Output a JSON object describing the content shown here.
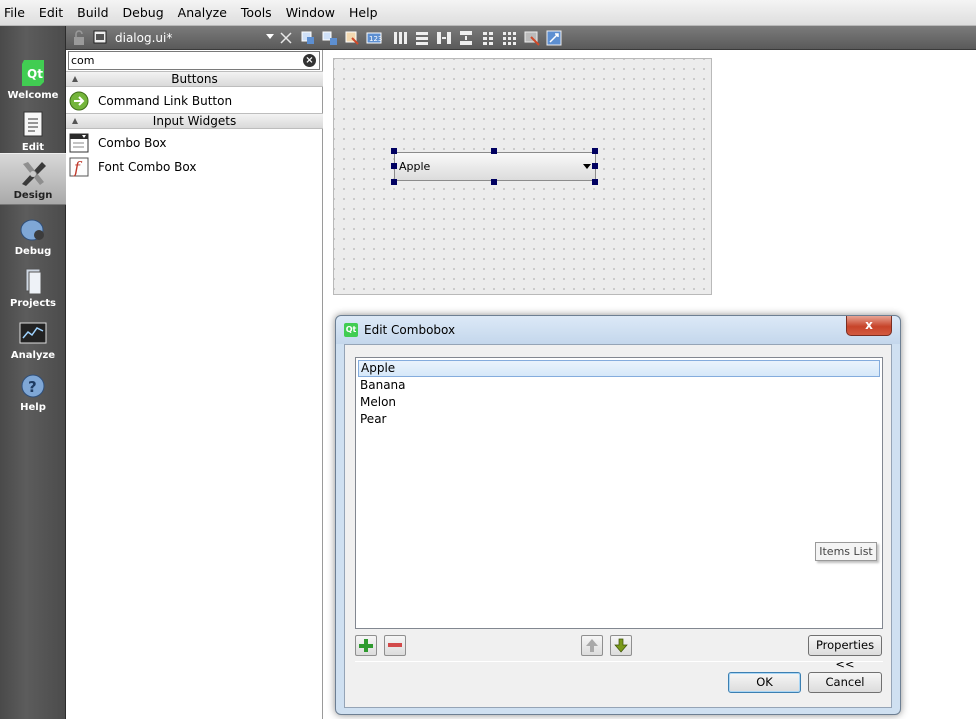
{
  "menu": [
    "File",
    "Edit",
    "Build",
    "Debug",
    "Analyze",
    "Tools",
    "Window",
    "Help"
  ],
  "modes": [
    {
      "label": "Welcome",
      "icon": "qt-logo-icon"
    },
    {
      "label": "Edit",
      "icon": "edit-document-icon"
    },
    {
      "label": "Design",
      "icon": "design-pen-icon",
      "active": true
    },
    {
      "label": "Debug",
      "icon": "debug-bug-icon"
    },
    {
      "label": "Projects",
      "icon": "projects-icon"
    },
    {
      "label": "Analyze",
      "icon": "analyze-monitor-icon"
    },
    {
      "label": "Help",
      "icon": "help-icon"
    }
  ],
  "editor": {
    "document": "dialog.ui*"
  },
  "widgetbox": {
    "filter": "com",
    "categories": [
      {
        "name": "Buttons",
        "items": [
          "Command Link Button"
        ]
      },
      {
        "name": "Input Widgets",
        "items": [
          "Combo Box",
          "Font Combo Box"
        ]
      }
    ]
  },
  "form": {
    "combo_value": "Apple"
  },
  "dialog": {
    "title": "Edit Combobox",
    "close": "x",
    "items": [
      "Apple",
      "Banana",
      "Melon",
      "Pear"
    ],
    "selected_index": 0,
    "tooltip": "Items List",
    "properties_button": "Properties <<",
    "ok": "OK",
    "cancel": "Cancel"
  },
  "colors": {
    "qt_green": "#41cd52",
    "modebar_dark": "#4a4a4a",
    "dialog_frame": "#cfe0f1",
    "selection_border": "#84acdd"
  }
}
